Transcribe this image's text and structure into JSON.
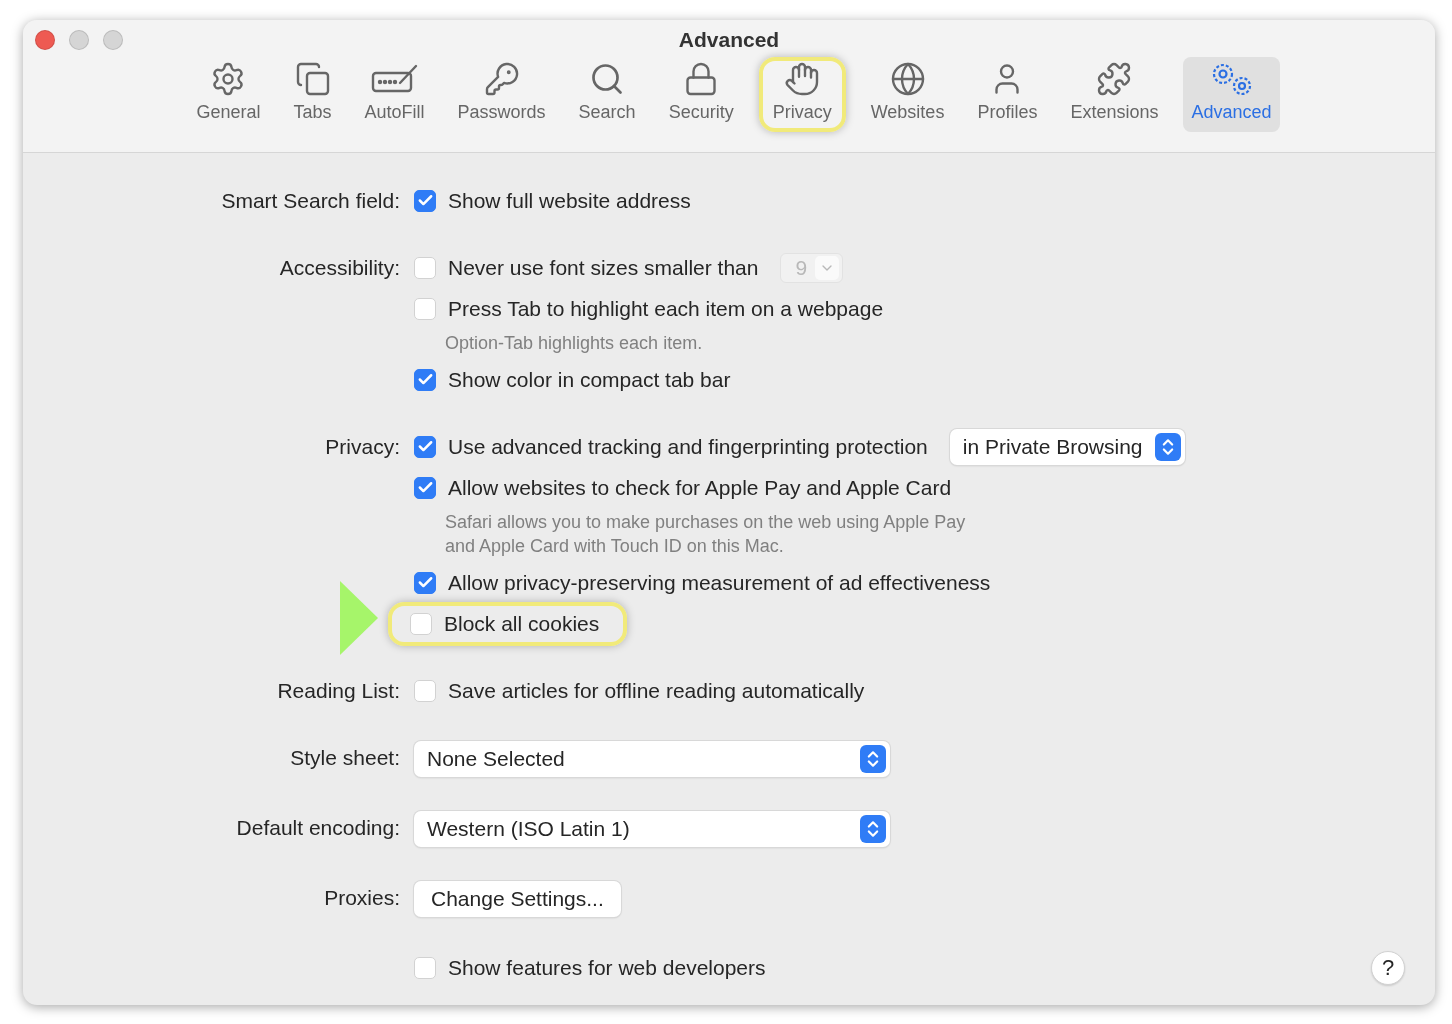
{
  "window": {
    "title": "Advanced"
  },
  "toolbar": [
    {
      "label": "General",
      "selected": false,
      "highlighted": false
    },
    {
      "label": "Tabs",
      "selected": false,
      "highlighted": false
    },
    {
      "label": "AutoFill",
      "selected": false,
      "highlighted": false
    },
    {
      "label": "Passwords",
      "selected": false,
      "highlighted": false
    },
    {
      "label": "Search",
      "selected": false,
      "highlighted": false
    },
    {
      "label": "Security",
      "selected": false,
      "highlighted": false
    },
    {
      "label": "Privacy",
      "selected": false,
      "highlighted": true
    },
    {
      "label": "Websites",
      "selected": false,
      "highlighted": false
    },
    {
      "label": "Profiles",
      "selected": false,
      "highlighted": false
    },
    {
      "label": "Extensions",
      "selected": false,
      "highlighted": false
    },
    {
      "label": "Advanced",
      "selected": true,
      "highlighted": false
    }
  ],
  "sections": [
    {
      "label": "Smart Search field:",
      "rows": [
        {
          "kind": "checkbox",
          "label": "Show full website address",
          "checked": true,
          "highlighted": false
        }
      ]
    },
    {
      "label": "Accessibility:",
      "rows": [
        {
          "kind": "checkbox",
          "label": "Never use font sizes smaller than",
          "checked": false,
          "highlighted": false,
          "stepper": {
            "value": "9",
            "disabled": true
          }
        },
        {
          "kind": "checkbox",
          "label": "Press Tab to highlight each item on a webpage",
          "checked": false,
          "highlighted": false,
          "note": "Option-Tab highlights each item."
        },
        {
          "kind": "checkbox",
          "label": "Show color in compact tab bar",
          "checked": true,
          "highlighted": false
        }
      ]
    },
    {
      "label": "Privacy:",
      "rows": [
        {
          "kind": "checkbox",
          "label": "Use advanced tracking and fingerprinting protection",
          "checked": true,
          "highlighted": false,
          "popup": "in Private Browsing"
        },
        {
          "kind": "checkbox",
          "label": "Allow websites to check for Apple Pay and Apple Card",
          "checked": true,
          "highlighted": false,
          "note": "Safari allows you to make purchases on the web using Apple Pay\nand Apple Card with Touch ID on this Mac."
        },
        {
          "kind": "checkbox",
          "label": "Allow privacy-preserving measurement of ad effectiveness",
          "checked": true,
          "highlighted": false
        },
        {
          "kind": "checkbox",
          "label": "Block all cookies",
          "checked": false,
          "highlighted": true
        }
      ]
    },
    {
      "label": "Reading List:",
      "rows": [
        {
          "kind": "checkbox",
          "label": "Save articles for offline reading automatically",
          "checked": false,
          "highlighted": false
        }
      ]
    },
    {
      "label": "Style sheet:",
      "rows": [
        {
          "kind": "popup",
          "value": "None Selected"
        }
      ]
    },
    {
      "label": "Default encoding:",
      "rows": [
        {
          "kind": "popup",
          "value": "Western (ISO Latin 1)"
        }
      ]
    },
    {
      "label": "Proxies:",
      "rows": [
        {
          "kind": "button",
          "label": "Change Settings..."
        }
      ]
    },
    {
      "rows": [
        {
          "kind": "checkbox",
          "label": "Show features for web developers",
          "checked": false,
          "highlighted": false
        }
      ]
    }
  ],
  "help": "?"
}
